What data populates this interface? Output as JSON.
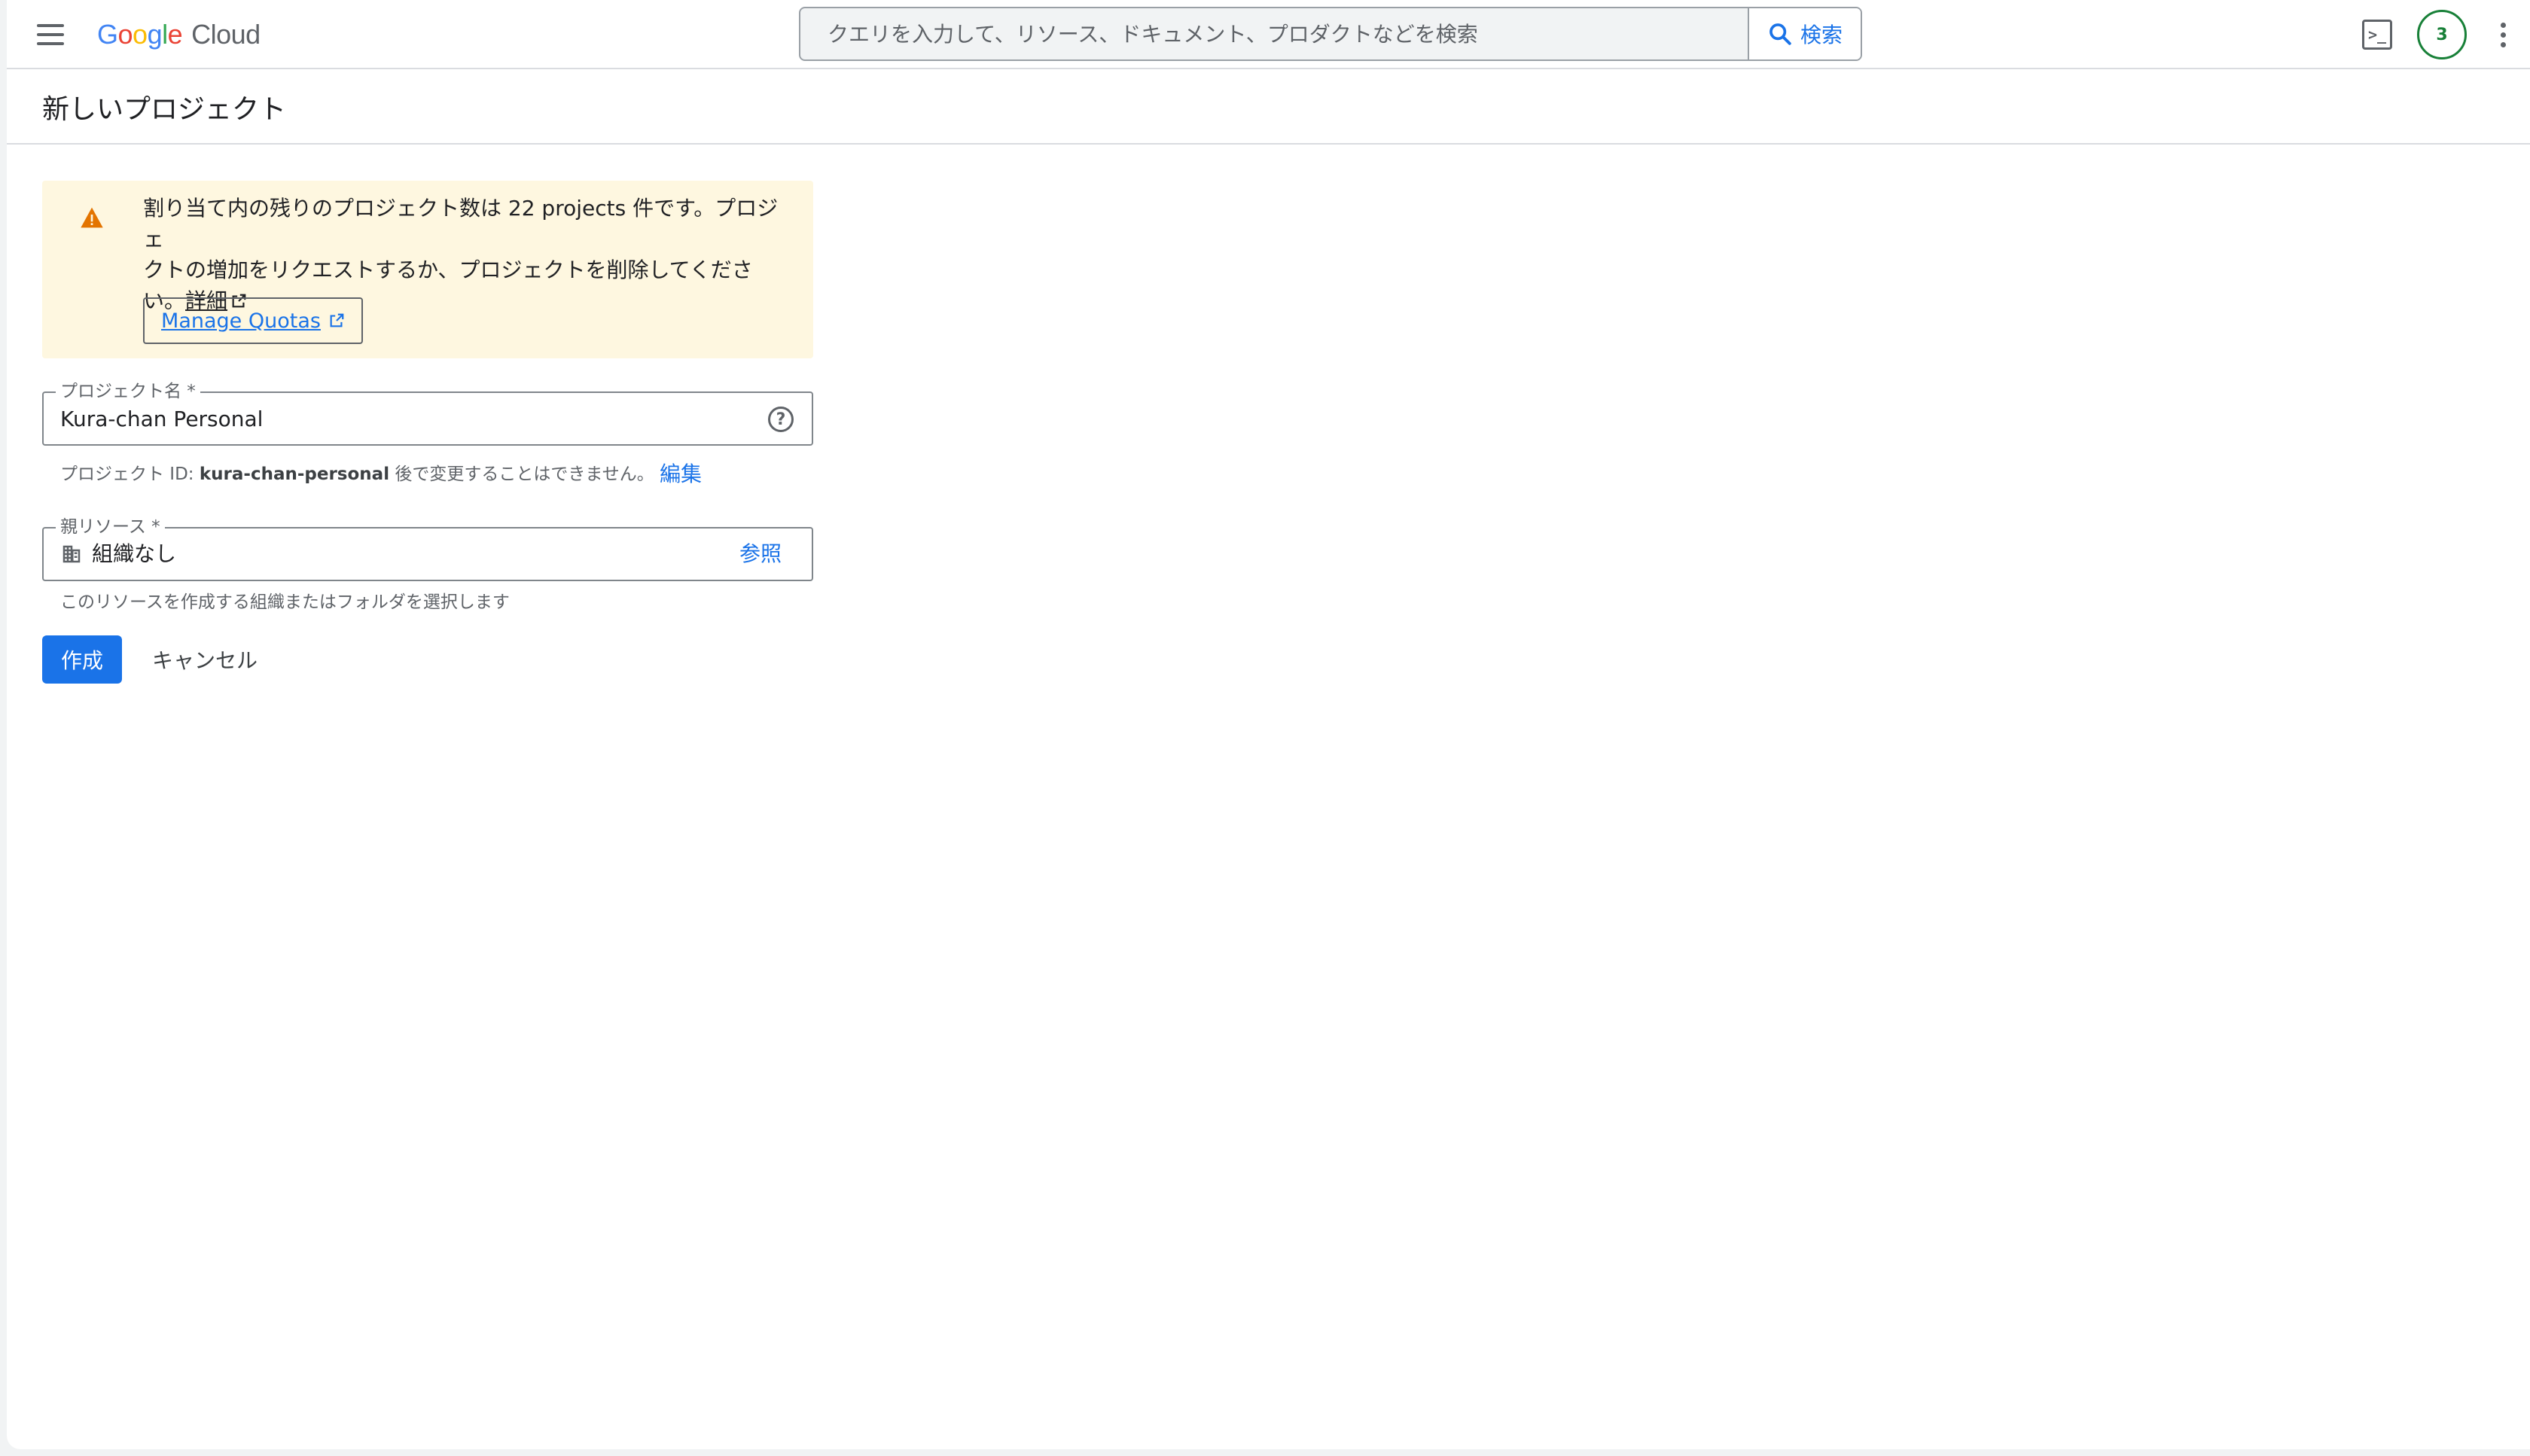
{
  "header": {
    "logo_google": [
      "G",
      "o",
      "o",
      "g",
      "l",
      "e"
    ],
    "logo_cloud": "Cloud",
    "search_placeholder": "クエリを入力して、リソース、ドキュメント、プロダクトなどを検索",
    "search_button": "検索",
    "notification_count": "3"
  },
  "page": {
    "title": "新しいプロジェクト"
  },
  "warning": {
    "line1": "割り当て内の残りのプロジェクト数は 22 projects 件です。プロジェ",
    "line2": "クトの増加をリクエストするか、プロジェクトを削除してくださ",
    "line3": "い。",
    "details_link": "詳細",
    "manage_quotas_button": "Manage Quotas"
  },
  "form": {
    "project_name_label": "プロジェクト名 *",
    "project_name_value": "Kura-chan Personal",
    "project_id_prefix": "プロジェクト ID: ",
    "project_id_value": "kura-chan-personal",
    "project_id_suffix": " 後で変更することはできません。",
    "edit_link": "編集",
    "parent_label": "親リソース *",
    "parent_value": "組織なし",
    "browse_link": "参照",
    "parent_hint": "このリソースを作成する組織またはフォルダを選択します",
    "create_button": "作成",
    "cancel_button": "キャンセル"
  },
  "colors": {
    "accent": "#1a73e8",
    "warning_bg": "#fef7e0",
    "warning_icon": "#e37400",
    "badge": "#188038"
  }
}
